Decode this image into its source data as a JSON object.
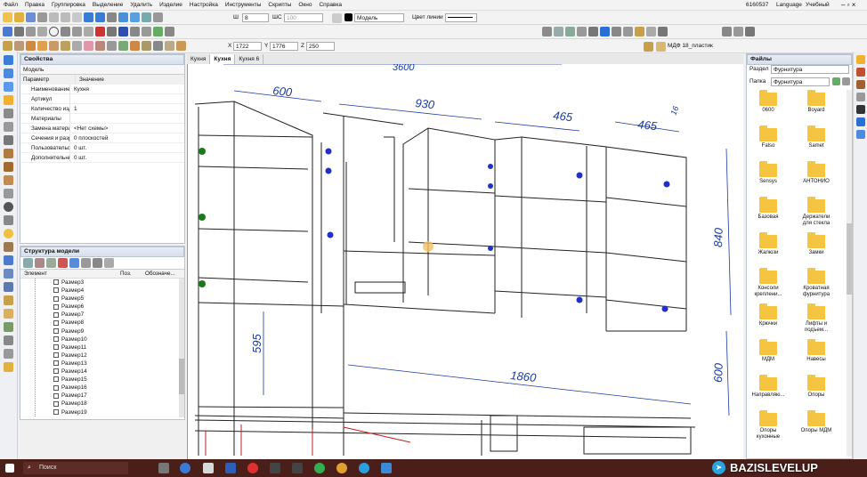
{
  "menu": [
    "Файл",
    "Правка",
    "Группировка",
    "Выделение",
    "Удалить",
    "Изделие",
    "Настройка",
    "Инструменты",
    "Скрипты",
    "Окно",
    "Справка"
  ],
  "menu_right": {
    "id": "6160537",
    "language": "Language",
    "mode": "Учебный"
  },
  "toolbar": {
    "width_label": "Ш",
    "width_value": "8",
    "shc_label": "ШС",
    "shc_value": "100",
    "layer": "Модель",
    "line_color_label": "Цвет линии"
  },
  "coords": {
    "x_label": "X",
    "x": "1722",
    "y_label": "Y",
    "y": "1776",
    "z_label": "Z",
    "z": "250"
  },
  "material": "МДФ 18_пластик",
  "props": {
    "title": "Свойства",
    "type": "Модель",
    "col_param": "Параметр",
    "col_value": "Значение",
    "rows": [
      {
        "k": "Наименование",
        "v": "Кухня"
      },
      {
        "k": "Артикул",
        "v": ""
      },
      {
        "k": "Количество изделий",
        "v": "1"
      },
      {
        "k": "Материалы",
        "v": ""
      },
      {
        "k": "Замена материалов",
        "v": "<Нет схемы>"
      },
      {
        "k": "Сечения и разрезы",
        "v": "0 плоскостей"
      },
      {
        "k": "Пользовательские",
        "v": "0 шт."
      },
      {
        "k": "Дополнительные",
        "v": "0 шт."
      }
    ]
  },
  "tree": {
    "title": "Структура модели",
    "col_element": "Элемент",
    "col_pos": "Поз.",
    "col_designation": "Обозначе...",
    "items": [
      "Размер3",
      "Размер4",
      "Размер5",
      "Размер6",
      "Размер7",
      "Размер8",
      "Размер9",
      "Размер10",
      "Размер11",
      "Размер12",
      "Размер13",
      "Размер14",
      "Размер15",
      "Размер16",
      "Размер17",
      "Размер18",
      "Размер19"
    ]
  },
  "tabs": [
    "Кухня",
    "Кухня",
    "Кухня 6"
  ],
  "dims": {
    "d600a": "600",
    "d930": "930",
    "d465a": "465",
    "d465b": "465",
    "d16": "16",
    "d840": "840",
    "d595": "595",
    "d1860": "1860",
    "d600b": "600",
    "dtop": "3600"
  },
  "files": {
    "title": "Файлы",
    "section_label": "Раздел",
    "section": "Фурнитура",
    "folder_label": "Папка",
    "folder": "Фурнитура",
    "items": [
      "0600",
      "Boyard",
      "Falso",
      "Samet",
      "Sensys",
      "АНТОНИО",
      "Базовая",
      "Держатели для стекла",
      "Жалюзи",
      "Замки",
      "Консоли креплени...",
      "Кроватная фурнитура",
      "Крючки",
      "Лифты и подъем...",
      "МДМ",
      "Навесы",
      "Направляю...",
      "Опоры",
      "Опоры кухонные",
      "Опоры МДМ"
    ]
  },
  "taskbar": {
    "search": "Поиск"
  },
  "brand": "BAZISLEVELUP"
}
